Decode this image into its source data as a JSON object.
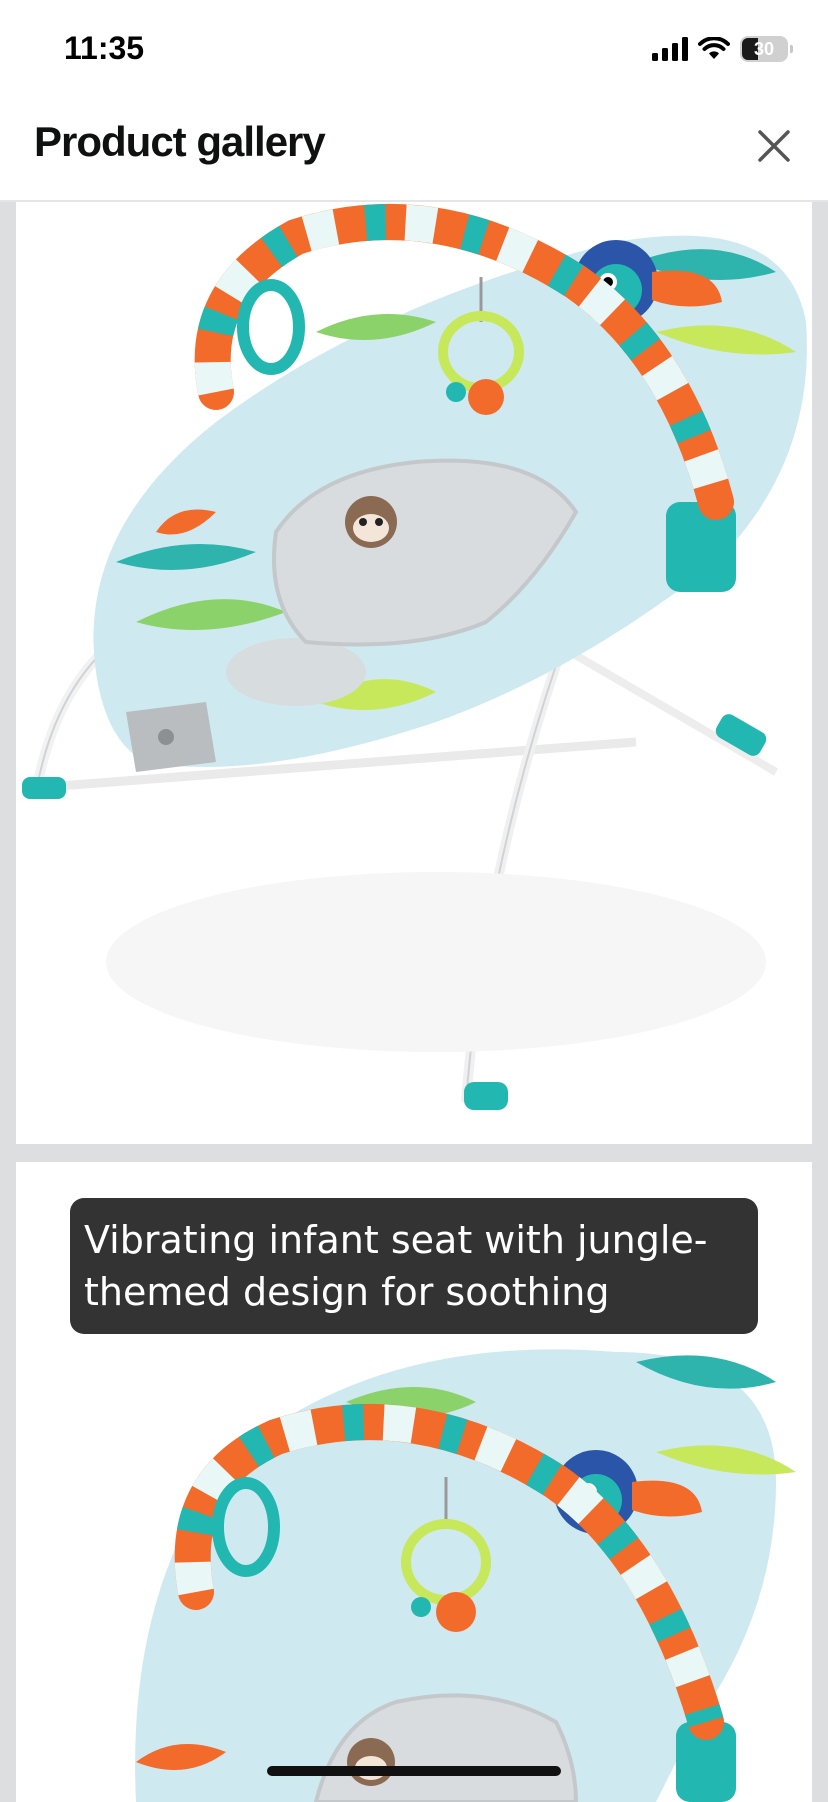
{
  "status_bar": {
    "time": "11:35",
    "battery_level": "30",
    "icons": [
      "signal-icon",
      "wifi-icon",
      "battery-icon"
    ]
  },
  "header": {
    "title": "Product gallery",
    "close_icon": "close-icon"
  },
  "gallery": {
    "images": [
      {
        "subject": "infant-bouncer-jungle-theme"
      },
      {
        "subject": "infant-bouncer-jungle-theme"
      }
    ],
    "caption": "Vibrating infant seat with jungle-themed design for soothing"
  },
  "colors": {
    "background": "#dcdedf",
    "caption_bg": "#333333",
    "seat_fabric": "#cfe9f1",
    "accent_orange": "#f26b2a",
    "accent_teal": "#22b7b0"
  }
}
